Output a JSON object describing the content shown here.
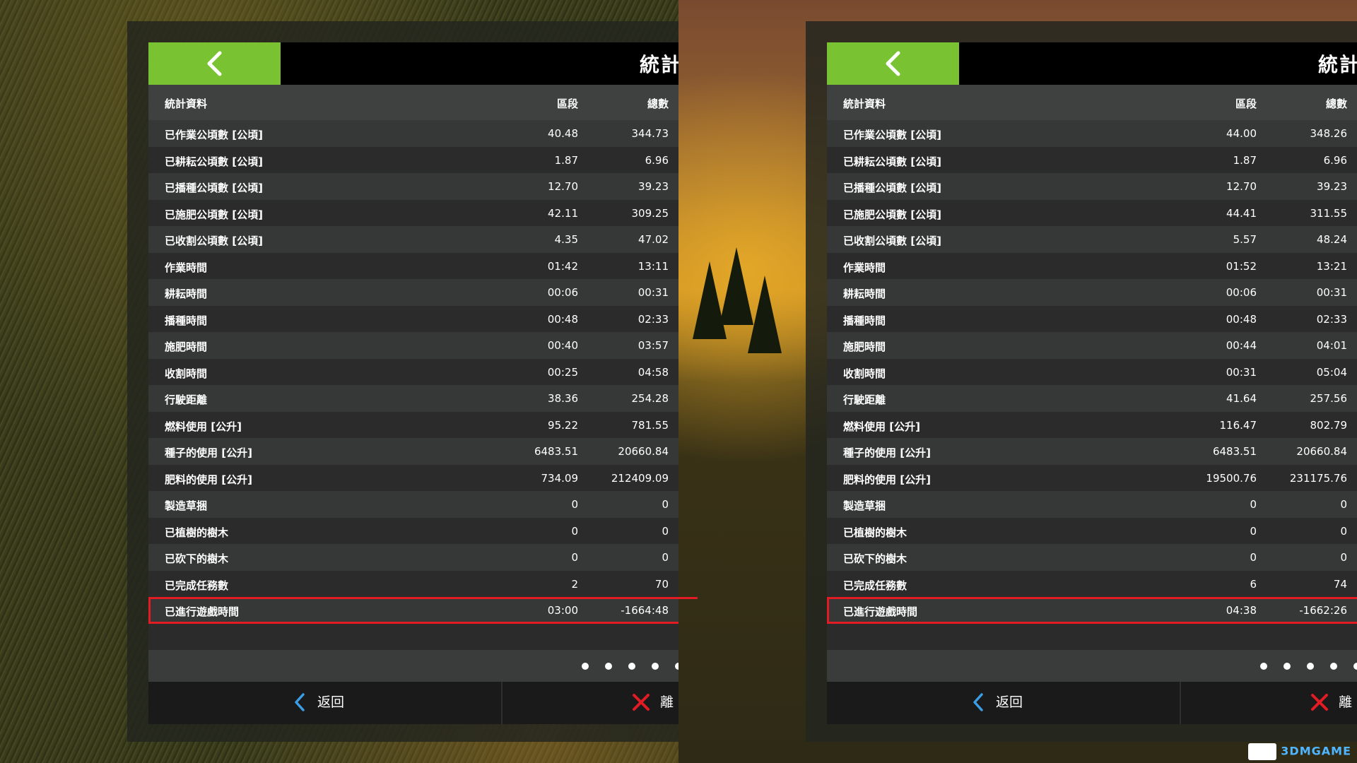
{
  "title": "統計",
  "headers": {
    "label": "統計資料",
    "segment": "區段",
    "total": "總數"
  },
  "labels": [
    "已作業公頃數 [公頃]",
    "已耕耘公頃數 [公頃]",
    "已播種公頃數 [公頃]",
    "已施肥公頃數 [公頃]",
    "已收割公頃數 [公頃]",
    "作業時間",
    "耕耘時間",
    "播種時間",
    "施肥時間",
    "收割時間",
    "行駛距離",
    "燃料使用 [公升]",
    "種子的使用 [公升]",
    "肥料的使用 [公升]",
    "製造草捆",
    "已植樹的樹木",
    "已砍下的樹木",
    "已完成任務數",
    "已進行遊戲時間"
  ],
  "left": {
    "segment": [
      "40.48",
      "1.87",
      "12.70",
      "42.11",
      "4.35",
      "01:42",
      "00:06",
      "00:48",
      "00:40",
      "00:25",
      "38.36",
      "95.22",
      "6483.51",
      "734.09",
      "0",
      "0",
      "0",
      "2",
      "03:00"
    ],
    "total": [
      "344.73",
      "6.96",
      "39.23",
      "309.25",
      "47.02",
      "13:11",
      "00:31",
      "02:33",
      "03:57",
      "04:58",
      "254.28",
      "781.55",
      "20660.84",
      "212409.09",
      "0",
      "0",
      "0",
      "70",
      "-1664:48"
    ]
  },
  "right": {
    "segment": [
      "44.00",
      "1.87",
      "12.70",
      "44.41",
      "5.57",
      "01:52",
      "00:06",
      "00:48",
      "00:44",
      "00:31",
      "41.64",
      "116.47",
      "6483.51",
      "19500.76",
      "0",
      "0",
      "0",
      "6",
      "04:38"
    ],
    "total": [
      "348.26",
      "6.96",
      "39.23",
      "311.55",
      "48.24",
      "13:21",
      "00:31",
      "02:33",
      "04:01",
      "05:04",
      "257.56",
      "802.79",
      "20660.84",
      "231175.76",
      "0",
      "0",
      "0",
      "74",
      "-1662:26"
    ]
  },
  "footer": {
    "back_label": "返回",
    "quit_label": "離"
  },
  "watermark": "3DMGAME",
  "colors": {
    "accent_green": "#79c232",
    "highlight_red": "#e21b24",
    "icon_blue": "#3d9de3",
    "quit_red": "#e21b24"
  },
  "icons": {
    "back_arrow": "chevron-left-icon",
    "footer_back": "chevron-left-icon",
    "quit": "close-icon"
  }
}
